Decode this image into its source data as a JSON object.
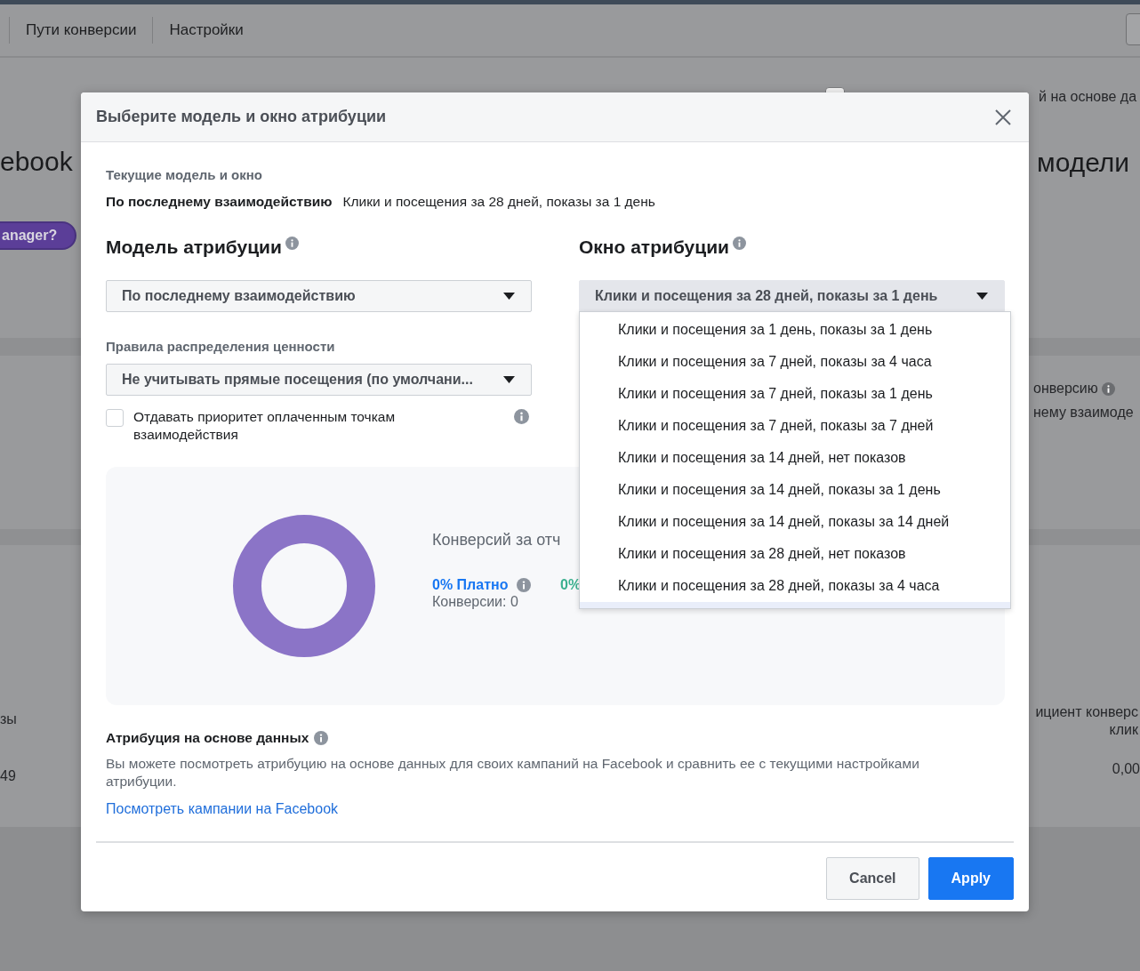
{
  "page": {
    "nav": [
      "Пути конверсии",
      "Настройки"
    ],
    "left_heading": "ebook",
    "right_heading": "модели",
    "help_pill": "anager?",
    "checkbox": {
      "label": "й на основе да",
      "checked": false
    },
    "conversion_label": "онверсию",
    "conversion_sub": "нему взаимоде",
    "left_column": [
      "зы",
      "49"
    ],
    "right_column": {
      "header": [
        "ициент конверс",
        "клик"
      ],
      "value": "0,00"
    }
  },
  "modal": {
    "title": "Выберите модель и окно атрибуции",
    "current": {
      "label": "Текущие модель и окно",
      "model": "По последнему взаимодействию",
      "window": "Клики и посещения за 28 дней, показы за 1 день"
    },
    "model": {
      "heading": "Модель атрибуции",
      "value": "По последнему взаимодействию"
    },
    "window": {
      "heading": "Окно атрибуции",
      "value": "Клики и посещения за 28 дней, показы за 1 день",
      "expanded": true,
      "options": [
        {
          "label": "Клики и посещения за 1 день, показы за 1 день",
          "selected": false
        },
        {
          "label": "Клики и посещения за 7 дней, показы за 4 часа",
          "selected": false
        },
        {
          "label": "Клики и посещения за 7 дней, показы за 1 день",
          "selected": false
        },
        {
          "label": "Клики и посещения за 7 дней, показы за 7 дней",
          "selected": false
        },
        {
          "label": "Клики и посещения за 14 дней, нет показов",
          "selected": false
        },
        {
          "label": "Клики и посещения за 14 дней, показы за 1 день",
          "selected": false
        },
        {
          "label": "Клики и посещения за 14 дней, показы за 14 дней",
          "selected": false
        },
        {
          "label": "Клики и посещения за 28 дней, нет показов",
          "selected": false
        },
        {
          "label": "Клики и посещения за 28 дней, показы за 4 часа",
          "selected": false
        }
      ]
    },
    "rules": {
      "label": "Правила распределения ценности",
      "value": "Не учитывать прямые посещения (по умолчани...",
      "checkbox": {
        "label": "Отдавать приоритет оплаченным точкам взаимодействия",
        "checked": false
      }
    },
    "summary": {
      "title": "Конверсий за отч",
      "legend": [
        {
          "kind": "paid",
          "percent": "0% Платно",
          "conversions": "Конверсии: 0"
        },
        {
          "kind": "organic",
          "percent": "0%"
        }
      ]
    },
    "data_driven": {
      "heading": "Атрибуция на основе данных",
      "text": "Вы можете посмотреть атрибуцию на основе данных для своих кампаний на Facebook и сравнить ее с текущими настройками атрибуции.",
      "link": "Посмотреть кампании на Facebook"
    },
    "buttons": [
      {
        "label": "Cancel",
        "kind": "secondary"
      },
      {
        "label": "Apply",
        "kind": "primary"
      }
    ]
  }
}
